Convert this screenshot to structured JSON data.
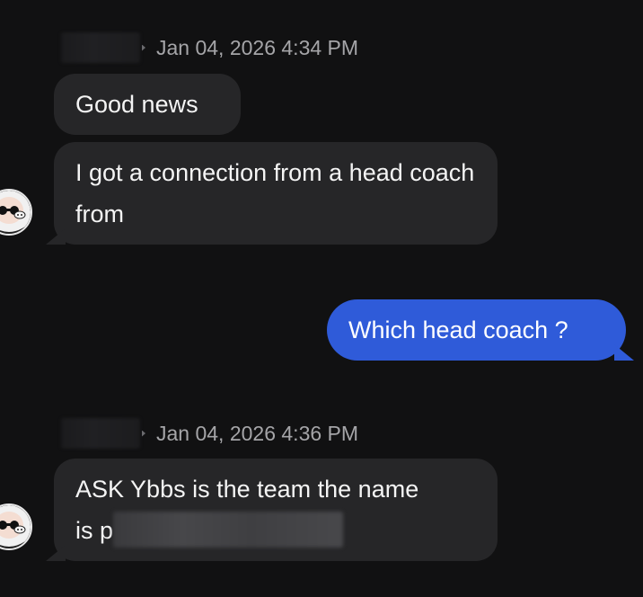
{
  "messages": [
    {
      "timestamp": "Jan 04, 2026 4:34 PM",
      "bubbles": [
        "Good news",
        "I got a connection from a head coach from"
      ]
    },
    {
      "outgoing": "Which head coach ?"
    },
    {
      "timestamp": "Jan 04, 2026 4:36 PM",
      "bubbles": [
        "ASK Ybbs is the team the name",
        "is p"
      ]
    }
  ],
  "colors": {
    "background": "#111112",
    "incoming_bubble": "#262628",
    "outgoing_bubble": "#2f5bd9",
    "timestamp_text": "#a5a5a8"
  },
  "icons": {
    "avatar": "cartoon-face-avatar-icon",
    "separator": "caret-right-icon"
  }
}
